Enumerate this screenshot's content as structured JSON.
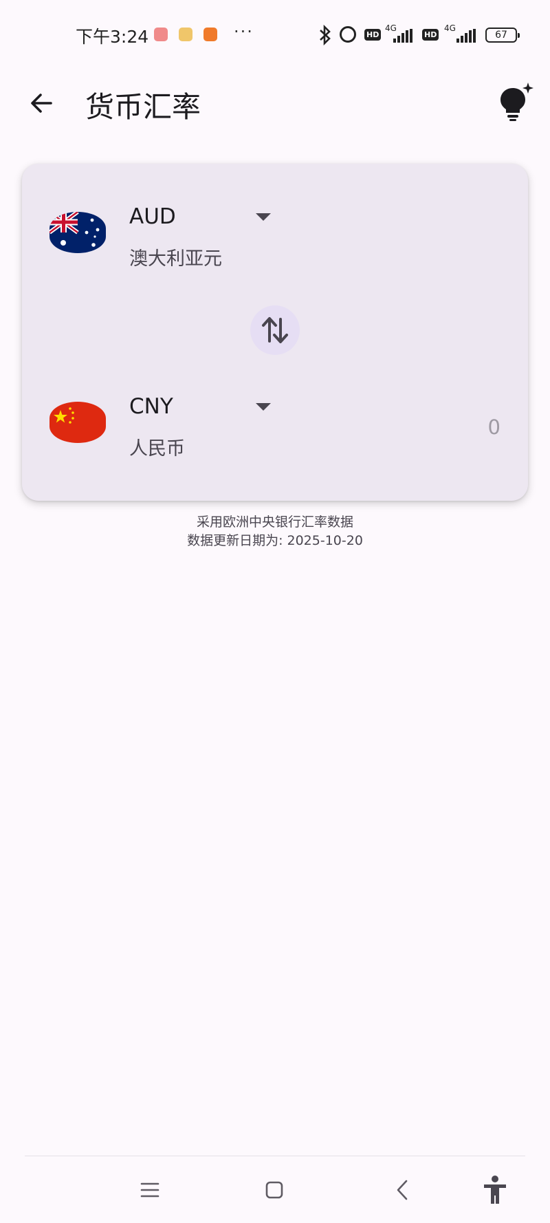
{
  "status_bar": {
    "time": "下午3:24",
    "more": "···",
    "network_1": "4G",
    "network_2": "4G",
    "hd_1": "HD",
    "hd_2": "HD",
    "battery": "67"
  },
  "header": {
    "title": "货币汇率"
  },
  "converter": {
    "from": {
      "code": "AUD",
      "name": "澳大利亚元",
      "amount": ""
    },
    "to": {
      "code": "CNY",
      "name": "人民币",
      "amount": "0"
    }
  },
  "footer_note": {
    "line1": "采用欧洲中央银行汇率数据",
    "line2": "数据更新日期为: 2025-10-20"
  },
  "colors": {
    "background": "#fdf9fd",
    "card": "#ede7f1",
    "swap_button": "#e6def4"
  }
}
